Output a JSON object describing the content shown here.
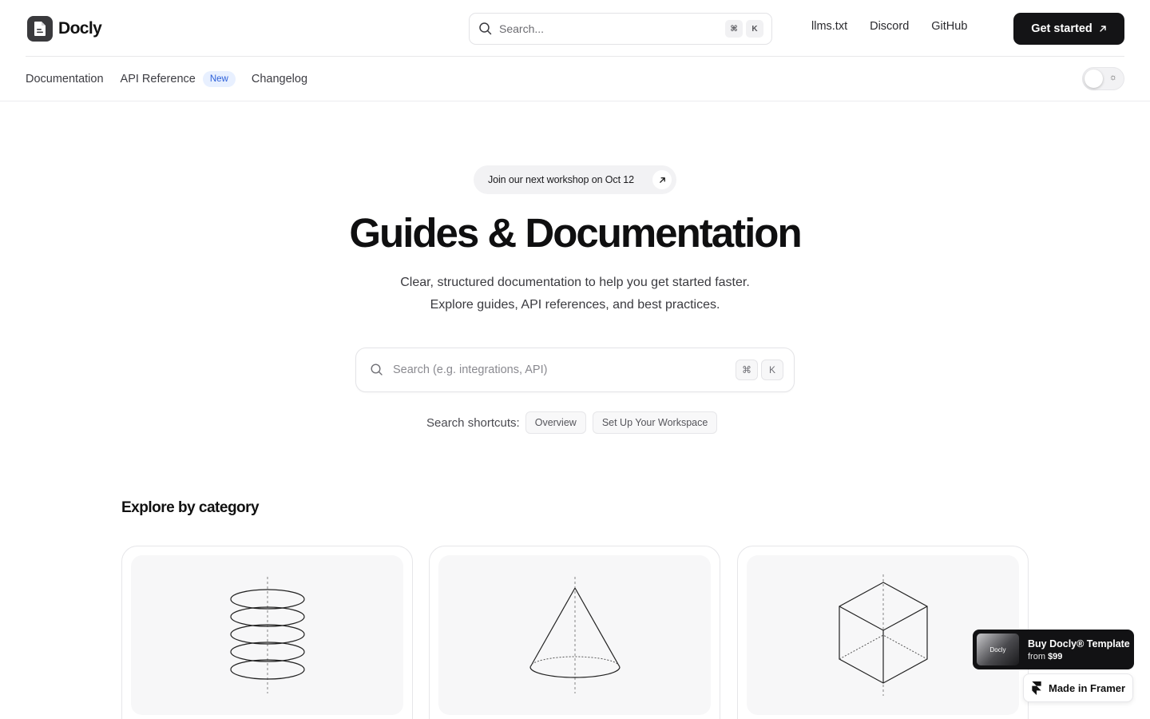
{
  "brand": {
    "name": "Docly"
  },
  "header": {
    "search_placeholder": "Search...",
    "search_kbd": [
      "⌘",
      "K"
    ],
    "links": [
      "llms.txt",
      "Discord",
      "GitHub"
    ],
    "cta_label": "Get started"
  },
  "subnav": {
    "items": [
      "Documentation",
      "API Reference",
      "Changelog"
    ],
    "api_badge": "New"
  },
  "hero": {
    "announcement": "Join our next workshop on Oct 12",
    "title": "Guides & Documentation",
    "subtitle_line1": "Clear, structured documentation to help you get started faster.",
    "subtitle_line2": "Explore guides, API references, and best practices.",
    "search_placeholder": "Search (e.g. integrations, API)",
    "search_kbd": [
      "⌘",
      "K"
    ],
    "shortcuts_label": "Search shortcuts:",
    "shortcuts": [
      "Overview",
      "Set Up Your Workspace"
    ]
  },
  "categories": {
    "title": "Explore by category",
    "cards": [
      {
        "icon": "stacked-rings-icon"
      },
      {
        "icon": "cone-icon"
      },
      {
        "icon": "cube-icon"
      }
    ]
  },
  "promo": {
    "thumb_label": "Docly",
    "title": "Buy Docly® Template",
    "price_prefix": "from",
    "price": "$99"
  },
  "framer_badge": {
    "label": "Made in Framer"
  }
}
